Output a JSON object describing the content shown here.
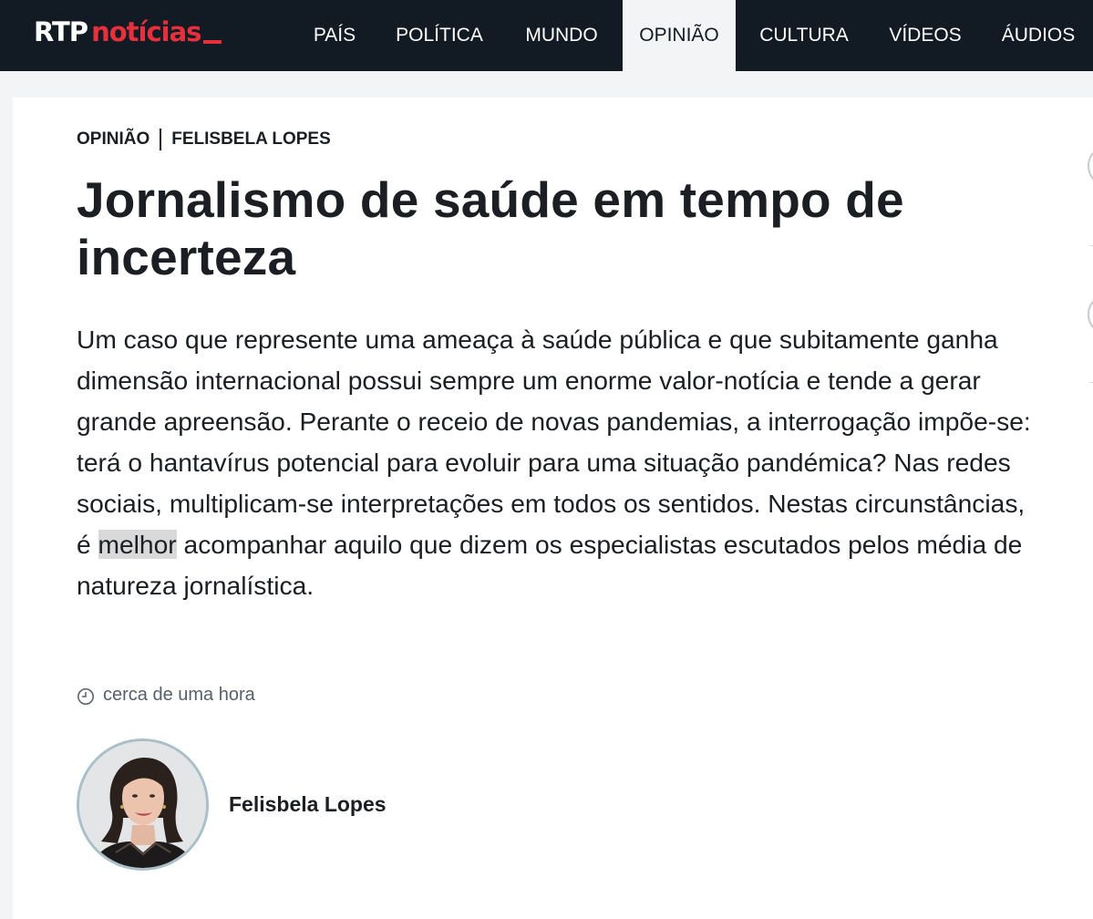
{
  "header": {
    "logo": {
      "primary": "RTP",
      "secondary": "notícias"
    },
    "nav": [
      {
        "label": "PAÍS",
        "active": false
      },
      {
        "label": "POLÍTICA",
        "active": false
      },
      {
        "label": "MUNDO",
        "active": false
      },
      {
        "label": "OPINIÃO",
        "active": true
      },
      {
        "label": "CULTURA",
        "active": false
      },
      {
        "label": "VÍDEOS",
        "active": false
      },
      {
        "label": "ÁUDIOS",
        "active": false
      }
    ]
  },
  "article": {
    "section": "OPINIÃO",
    "columnist": "FELISBELA LOPES",
    "title": "Jornalismo de saúde em tempo de incerteza",
    "lead_before": "Um caso que represente uma ameaça à saúde pública e que subitamente ganha dimensão internacional possui sempre um enorme valor-notícia e tende a gerar grande apreensão. Perante o receio de novas pandemias, a interrogação impõe-se: terá o hantavírus potencial para evoluir para uma situação pandémica? Nas redes sociais, multiplicam-se interpretações em todos os sentidos. Nestas circunstâncias, é ",
    "lead_highlight": "melhor",
    "lead_after": " acompanhar aquilo que dizem os especialistas escutados pelos média de natureza jornalística.",
    "timestamp": "cerca de uma hora",
    "author_name": "Felisbela Lopes"
  },
  "colors": {
    "nav_background": "#121a24",
    "brand_red": "#e8303d",
    "page_background": "#f3f4f6",
    "text": "#1b1e23",
    "muted_text": "#55606c",
    "highlight": "#d9d9d9"
  },
  "icons": {
    "timestamp": "clock-icon"
  }
}
